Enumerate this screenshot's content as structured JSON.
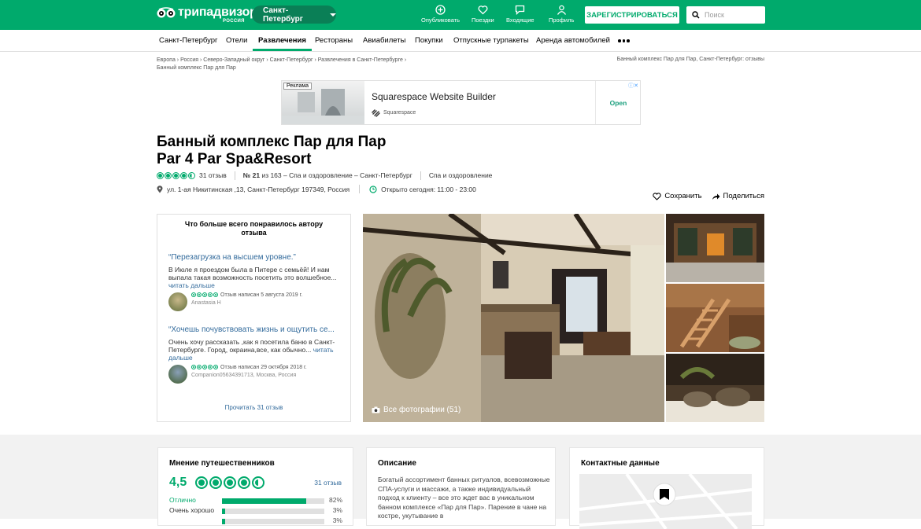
{
  "header": {
    "logo_text": "трипадвизор",
    "logo_sub": "РОССИЯ",
    "city": "Санкт-Петербург",
    "nav": [
      {
        "label": "Опубликовать",
        "icon": "plus-circle-icon"
      },
      {
        "label": "Поездки",
        "icon": "heart-icon"
      },
      {
        "label": "Входящие",
        "icon": "chat-icon"
      },
      {
        "label": "Профиль",
        "icon": "user-icon"
      }
    ],
    "register_label": "ЗАРЕГИСТРИРОВАТЬСЯ",
    "search_placeholder": "Поиск"
  },
  "subnav": {
    "items": [
      "Санкт-Петербург",
      "Отели",
      "Развлечения",
      "Рестораны",
      "Авиабилеты",
      "Покупки",
      "Отпускные турпакеты",
      "Аренда автомобилей"
    ],
    "active_index": 2
  },
  "breadcrumbs": {
    "items": [
      "Европа",
      "Россия",
      "Северо-Западный округ",
      "Санкт-Петербург",
      "Развлечения в Санкт-Петербурге"
    ],
    "current": "Банный комплекс Пар для Пар",
    "right": "Банный комплекс Пар для Пар, Санкт-Петербург: отзывы"
  },
  "ad": {
    "label": "Реклама",
    "title": "Squarespace Website Builder",
    "brand": "Squarespace",
    "cta": "Open"
  },
  "place": {
    "title_line1": "Банный комплекс Пар для Пар",
    "title_line2": "Par 4 Par Spa&Resort",
    "rating": 4.5,
    "reviews": "31 отзыв",
    "rank_num": "№ 21",
    "rank_rest": "из 163 – Спа и оздоровление – Санкт-Петербург",
    "category": "Спа и оздоровление",
    "address": "ул. 1-ая Никитинская ,13, Санкт-Петербург 197349, Россия",
    "hours": "Открыто сегодня: 11:00 - 23:00",
    "save_label": "Сохранить",
    "share_label": "Поделиться"
  },
  "highlights": {
    "title": "Что больше всего понравилось автору отзыва",
    "reviews": [
      {
        "quote": "“Перезагрузка на высшем уровне.”",
        "text": "В Июле я проездом была в Питере с семьёй! И нам выпала такая возможность посетить это волшебное...",
        "more": "читать дальше",
        "date": "Отзыв написан 5 августа 2019 г.",
        "author": "Anastasia H"
      },
      {
        "quote": "“Хочешь почувствовать жизнь и ощутить се...",
        "text": "Очень хочу рассказать ,как я посетила баню в Санкт-Петербурге. Город, окраина,все, как обычно...",
        "more": "читать дальше",
        "date": "Отзыв написан 29 октября 2018 г.",
        "author": "Companion05634391713, Москва, Россия"
      }
    ],
    "read_all": "Прочитать 31 отзыв"
  },
  "photos": {
    "caption": "Все фотографии (51)"
  },
  "opinion": {
    "title": "Мнение путешественников",
    "score": "4,5",
    "count": "31 отзыв",
    "bars": [
      {
        "label": "Отлично",
        "pct": 82,
        "text": "82%"
      },
      {
        "label": "Очень хорошо",
        "pct": 3,
        "text": "3%"
      },
      {
        "label": "",
        "pct": 3,
        "text": "3%"
      }
    ]
  },
  "description": {
    "title": "Описание",
    "text": "Богатый ассортимент банных ритуалов, всевозможные СПА-услуги и массажи, а также индивидуальный подход к клиенту – все это ждет вас в уникальном банном комплексе «Пар для Пар». Парение в чане на костре, укутывание в"
  },
  "contacts": {
    "title": "Контактные данные"
  },
  "colors": {
    "brand": "#00aa6c",
    "link": "#336b9c"
  }
}
